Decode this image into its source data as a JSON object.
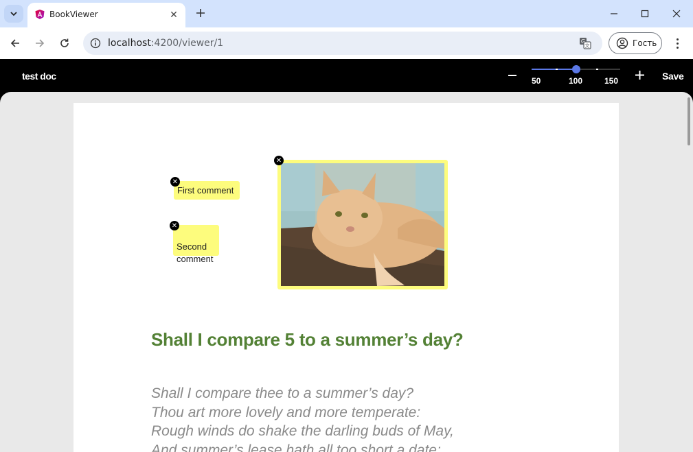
{
  "browser": {
    "tab_title": "BookViewer",
    "url_host": "localhost",
    "url_rest": ":4200/viewer/1",
    "profile_label": "Гость"
  },
  "app": {
    "title": "test doc",
    "save_label": "Save",
    "zoom": {
      "value": 100,
      "min": 50,
      "max": 150,
      "labels": [
        "50",
        "100",
        "150"
      ]
    }
  },
  "comments": [
    {
      "text": "First comment"
    },
    {
      "text": "Second\ncomment"
    }
  ],
  "document": {
    "heading": "Shall I compare 5 to a summer’s day?",
    "poem_lines": [
      "Shall I compare thee to a summer’s day?",
      "Thou art more lovely and more temperate:",
      "Rough winds do shake the darling buds of May,",
      "And summer’s lease hath all too short a date;"
    ]
  },
  "colors": {
    "accent": "#5b78e6",
    "comment_bg": "#fdfc7d",
    "heading": "#538135",
    "poem": "#8a8a8a"
  }
}
